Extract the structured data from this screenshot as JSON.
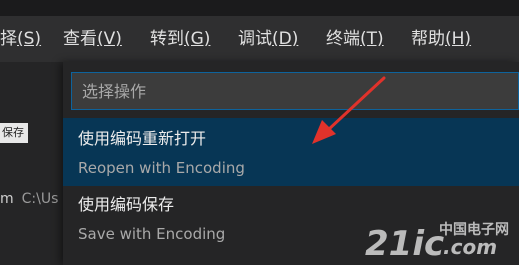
{
  "menu": {
    "items": [
      {
        "text": "择",
        "mnemonic": "(S)",
        "name": "menu-selection"
      },
      {
        "text": "查看",
        "mnemonic": "(V)",
        "name": "menu-view"
      },
      {
        "text": "转到",
        "mnemonic": "(G)",
        "name": "menu-go"
      },
      {
        "text": "调试",
        "mnemonic": "(D)",
        "name": "menu-debug"
      },
      {
        "text": "终端",
        "mnemonic": "(T)",
        "name": "menu-terminal"
      },
      {
        "text": "帮助",
        "mnemonic": "(H)",
        "name": "menu-help"
      }
    ]
  },
  "background": {
    "save_fragment": "保存",
    "path_fragment": "m",
    "path_dim": "C:\\Us"
  },
  "quickpick": {
    "placeholder": "选择操作",
    "items": [
      {
        "label": "使用编码重新打开",
        "description": "Reopen with Encoding"
      },
      {
        "label": "使用编码保存",
        "description": "Save with Encoding"
      }
    ]
  },
  "watermark": {
    "logo": "21ic",
    "site": "中国电子网",
    "domain": ".com"
  },
  "colors": {
    "accent_border": "#0e639c",
    "selected_bg": "#073655",
    "arrow": "#e0322b",
    "watermark": "#d6d6d6"
  }
}
